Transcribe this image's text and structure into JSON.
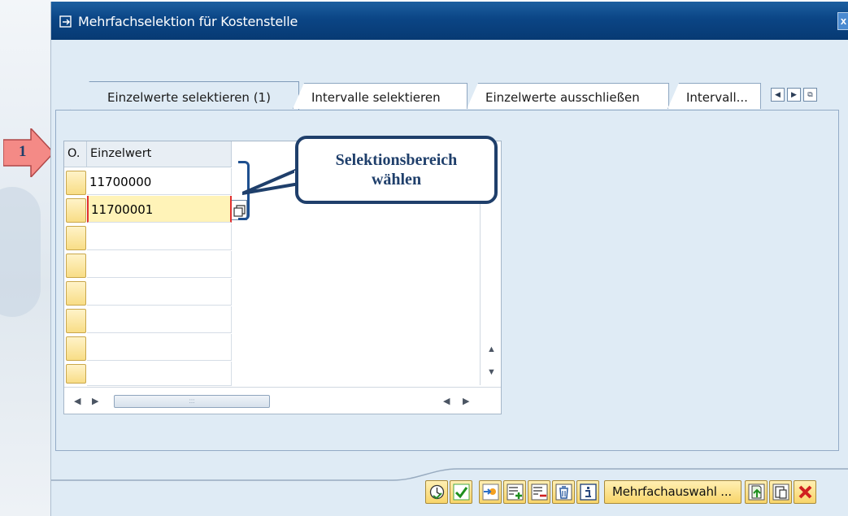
{
  "window": {
    "title": "Mehrfachselektion für Kostenstelle",
    "close_label": "x"
  },
  "tabs": [
    {
      "label": "Einzelwerte selektieren (1)",
      "active": true
    },
    {
      "label": "Intervalle selektieren",
      "active": false
    },
    {
      "label": "Einzelwerte ausschließen",
      "active": false
    },
    {
      "label": "Intervall...",
      "active": false
    }
  ],
  "tab_nav": [
    "scroll-left-icon",
    "scroll-right-icon",
    "tab-list-icon"
  ],
  "table": {
    "col_o": "O.",
    "col_value": "Einzelwert",
    "rows": [
      "11700000",
      "11700001",
      "",
      "",
      "",
      "",
      "",
      ""
    ],
    "focused_row": 1
  },
  "annotation": {
    "step": "1",
    "callout_line1": "Selektionsbereich",
    "callout_line2": "wählen"
  },
  "footer": {
    "buttons": [
      "execute-icon",
      "check-icon",
      "import-icon",
      "insert-line-icon",
      "delete-line-icon",
      "trash-icon",
      "info-icon"
    ],
    "multi_label": "Mehrfachauswahl ...",
    "right_buttons": [
      "upload-icon",
      "clipboard-icon",
      "cancel-icon"
    ]
  },
  "colors": {
    "titlebar": "#0b4585",
    "panel": "#dfebf5",
    "accent": "#1f3f6b",
    "button_yellow": "#f8d56a",
    "step_arrow": "#f07f7f"
  }
}
